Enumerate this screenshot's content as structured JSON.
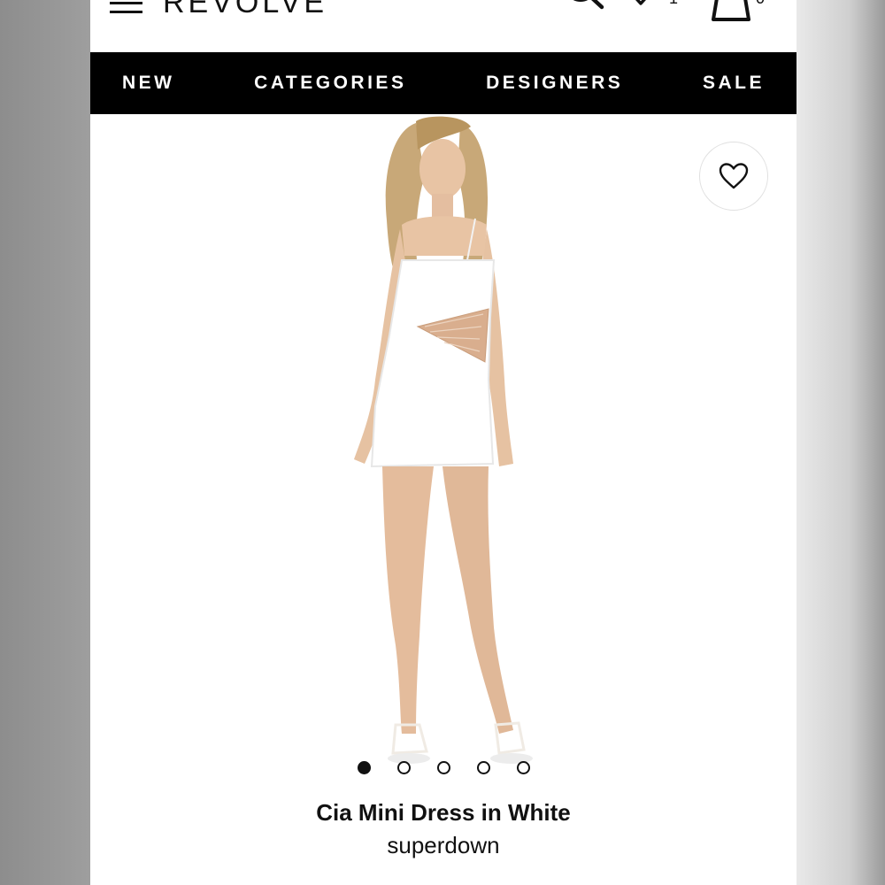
{
  "header": {
    "logo_text": "REVOLVE",
    "wishlist_count": "1",
    "bag_count": "0",
    "icons": [
      "menu-icon",
      "search-icon",
      "heart-icon",
      "bag-icon"
    ]
  },
  "nav": {
    "items": [
      {
        "label": "NEW"
      },
      {
        "label": "CATEGORIES"
      },
      {
        "label": "DESIGNERS"
      },
      {
        "label": "SALE"
      }
    ]
  },
  "gallery": {
    "image_count": 5,
    "active_index": 0,
    "favorite_icon": "heart-outline-icon"
  },
  "product": {
    "name": "Cia Mini Dress in White",
    "brand": "superdown"
  },
  "colors": {
    "nav_bg": "#000000",
    "nav_text": "#ffffff",
    "page_bg": "#ffffff"
  }
}
